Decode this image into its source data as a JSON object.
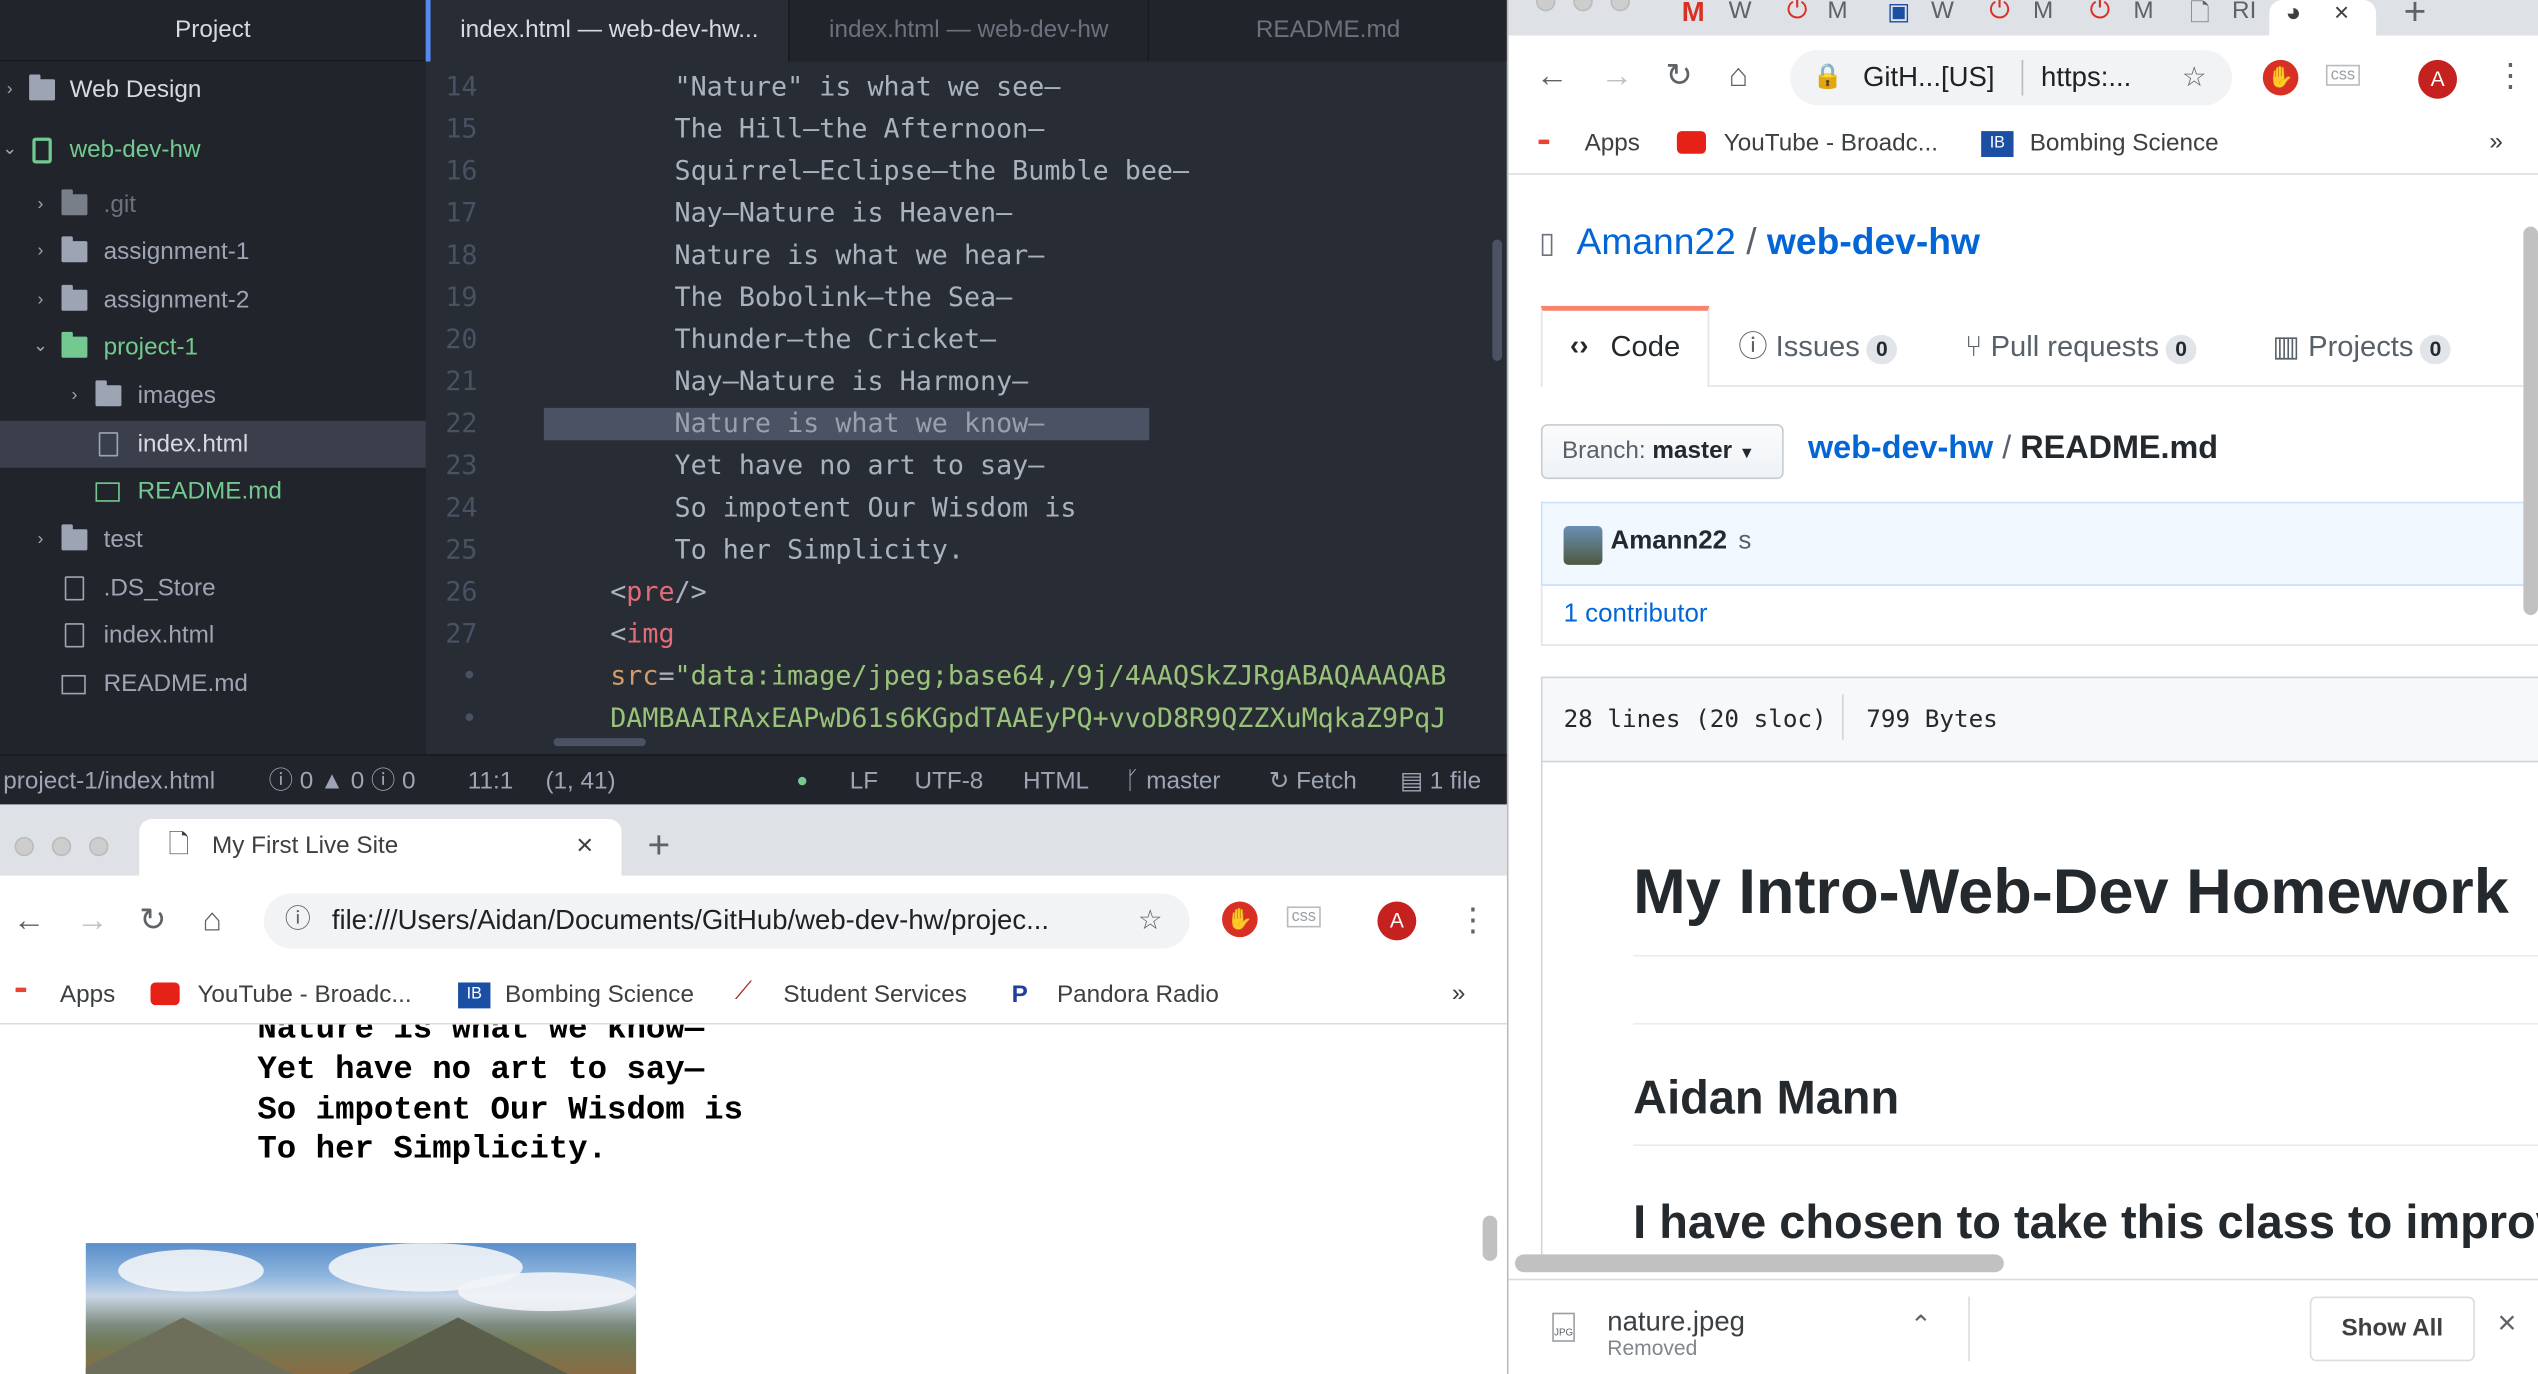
{
  "editor": {
    "tree": {
      "header": "Project",
      "items": [
        {
          "label": "Web Design"
        },
        {
          "label": "web-dev-hw"
        },
        {
          "label": ".git"
        },
        {
          "label": "assignment-1"
        },
        {
          "label": "assignment-2"
        },
        {
          "label": "project-1"
        },
        {
          "label": "images"
        },
        {
          "label": "index.html"
        },
        {
          "label": "README.md"
        },
        {
          "label": "test"
        },
        {
          "label": ".DS_Store"
        },
        {
          "label": "index.html"
        },
        {
          "label": "README.md"
        }
      ]
    },
    "tabs": [
      "index.html — web-dev-hw...",
      "index.html — web-dev-hw",
      "README.md"
    ],
    "lines": [
      {
        "n": "14",
        "t": "    \"Nature\" is what we see—"
      },
      {
        "n": "15",
        "t": "    The Hill—the Afternoon—"
      },
      {
        "n": "16",
        "t": "    Squirrel—Eclipse—the Bumble bee—"
      },
      {
        "n": "17",
        "t": "    Nay—Nature is Heaven—"
      },
      {
        "n": "18",
        "t": "    Nature is what we hear—"
      },
      {
        "n": "19",
        "t": "    The Bobolink—the Sea—"
      },
      {
        "n": "20",
        "t": "    Thunder—the Cricket—"
      },
      {
        "n": "21",
        "t": "    Nay—Nature is Harmony—"
      },
      {
        "n": "22",
        "t": "    Nature is what we know—"
      },
      {
        "n": "23",
        "t": "    Yet have no art to say—"
      },
      {
        "n": "24",
        "t": "    So impotent Our Wisdom is"
      },
      {
        "n": "25",
        "t": "    To her Simplicity."
      },
      {
        "n": "26",
        "t": ""
      },
      {
        "n": "27",
        "t": ""
      },
      {
        "n": "•",
        "t": ""
      },
      {
        "n": "•",
        "t": ""
      }
    ],
    "code_26": {
      "open": "<",
      "tag": "pre",
      "close": "/>"
    },
    "code_27": {
      "open": "<",
      "tag": "img"
    },
    "code_28": {
      "attr": "src",
      "eq": "=",
      "str": "\"data:image/jpeg;base64,/9j/4AAQSkZJRgABAQAAAQAB"
    },
    "code_29": {
      "str": "DAMBAAIRAxEAPwD61s6KGpdTAAEyPQ+vvoD8R9QZZXuMqkaZ9PqJ"
    },
    "status": {
      "path": "project-1/index.html",
      "diagnostics": "0",
      "warnings": "0",
      "infos": "0",
      "cursor": "11:1",
      "selection": "(1, 41)",
      "line_ending": "LF",
      "encoding": "UTF-8",
      "grammar": "HTML",
      "branch": "master",
      "fetch": "Fetch",
      "files": "1 file"
    }
  },
  "site_window": {
    "tab_title": "My First Live Site",
    "url": "file:///Users/Aidan/Documents/GitHub/web-dev-hw/projec...",
    "bookmarks": [
      "Apps",
      "YouTube - Broadc...",
      "Bombing Science",
      "Student Services",
      "Pandora Radio"
    ],
    "avatar": "A",
    "poem": [
      "Nature is what we know—",
      "Yet have no art to say—",
      "So impotent Our Wisdom is",
      "To her Simplicity."
    ]
  },
  "github_window": {
    "tabs": [
      "W",
      "M",
      "W",
      "M",
      "M",
      "RI"
    ],
    "address_short": "GitH...[US]",
    "address_url": "https:...",
    "bookmarks": [
      "Apps",
      "YouTube - Broadc...",
      "Bombing Science"
    ],
    "avatar": "A",
    "owner": "Amann22",
    "sep": "/",
    "repo": "web-dev-hw",
    "nav": [
      {
        "label": "Code",
        "count": ""
      },
      {
        "label": "Issues",
        "count": "0"
      },
      {
        "label": "Pull requests",
        "count": "0"
      },
      {
        "label": "Projects",
        "count": "0"
      }
    ],
    "branch_prefix": "Branch:",
    "branch": "master",
    "breadcrumb_repo": "web-dev-hw",
    "breadcrumb_file": "README.md",
    "commit_author": "Amann22",
    "commit_msg": "s",
    "contributors": "1 contributor",
    "file_lines": "28 lines (20 sloc)",
    "file_size": "799 Bytes",
    "readme_h1": "My Intro-Web-Dev Homework",
    "readme_h2": "Aidan Mann",
    "readme_h3": "I have chosen to take this class to improv",
    "download_name": "nature.jpeg",
    "download_status": "Removed",
    "show_all": "Show All"
  },
  "colors": {
    "editor_bg": "#282c34",
    "tree_bg": "#21252b",
    "git_added": "#73c990",
    "github_link": "#0366d6",
    "github_tab_accent": "#f9826c"
  }
}
